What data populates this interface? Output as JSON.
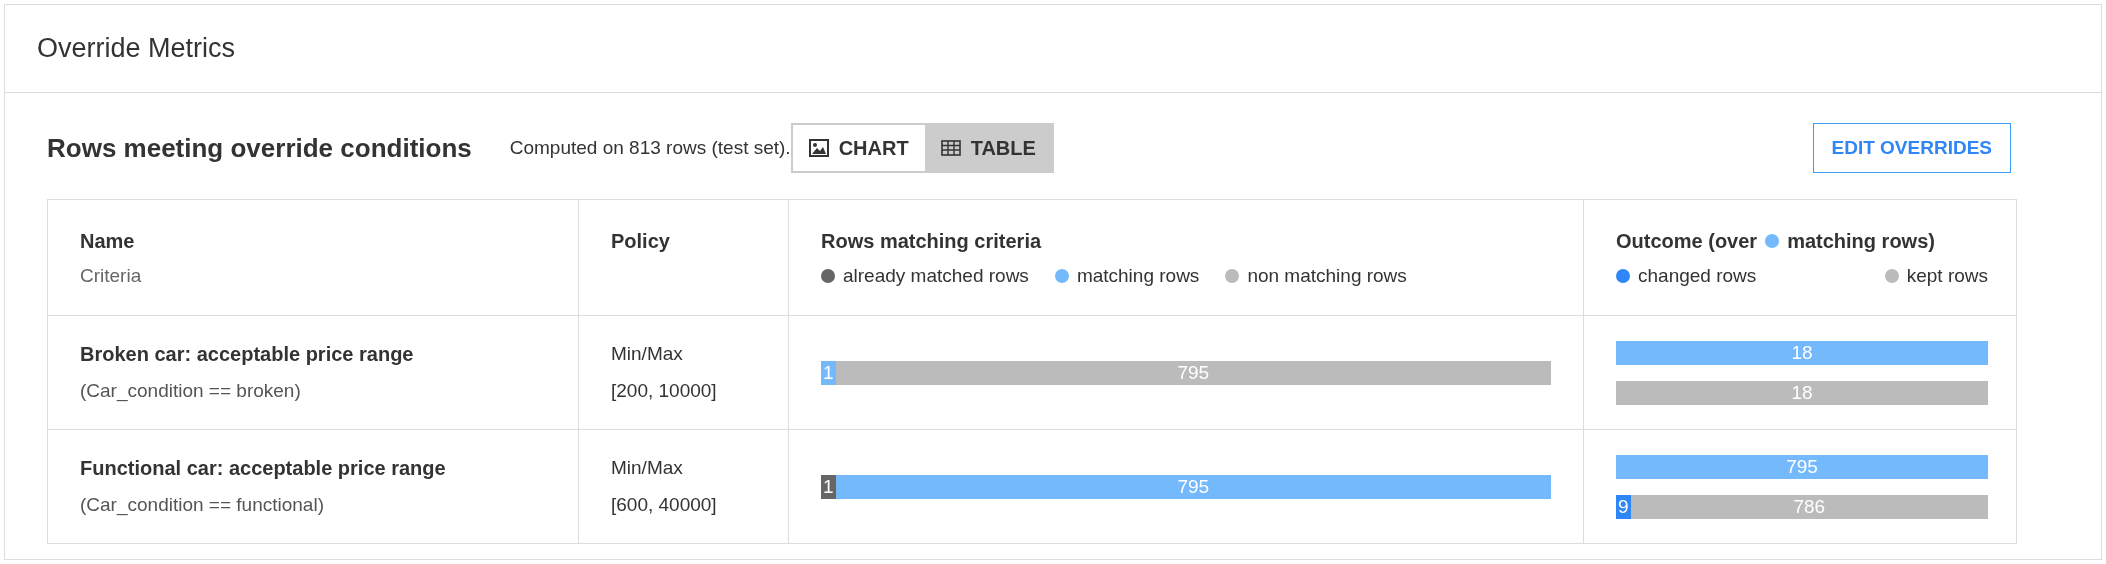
{
  "panel_title": "Override Metrics",
  "section": {
    "title": "Rows meeting override conditions",
    "computed_note": "Computed on 813 rows (test set).",
    "view_toggle": [
      {
        "label": "CHART",
        "kind": "image",
        "selected": false
      },
      {
        "label": "TABLE",
        "kind": "table",
        "selected": true
      }
    ],
    "edit_button": "EDIT OVERRIDES"
  },
  "table": {
    "columns": [
      {
        "title": "Name",
        "subtitle": "Criteria"
      },
      {
        "title": "Policy"
      },
      {
        "title": "Rows matching criteria",
        "legend": [
          {
            "label": "already matched rows",
            "color": "#666666"
          },
          {
            "label": "matching rows",
            "color": "#74b9fc"
          },
          {
            "label": "non matching rows",
            "color": "#bbbbbb"
          }
        ]
      },
      {
        "title_before": "Outcome (over",
        "title_after": "matching rows)",
        "legend": [
          {
            "label": "changed rows",
            "color": "#2f86f6"
          },
          {
            "label": "kept rows",
            "color": "#bbbbbb"
          }
        ]
      }
    ],
    "rows": [
      {
        "name": "Broken car: acceptable price range",
        "criteria": "(Car_condition == broken)",
        "policy": "Min/Max",
        "range": "[200, 10000]",
        "matching_bar": [
          {
            "label": "1",
            "color": "#74b9fc",
            "kind": "sliver"
          },
          {
            "label": "795",
            "color": "#bbbbbb",
            "kind": "rest"
          }
        ],
        "outcome_bars": [
          [
            {
              "label": "18",
              "color": "#74b9fc",
              "kind": "rest"
            }
          ],
          [
            {
              "label": "18",
              "color": "#bbbbbb",
              "kind": "rest"
            }
          ]
        ]
      },
      {
        "name": "Functional car: acceptable price range",
        "criteria": "(Car_condition == functional)",
        "policy": "Min/Max",
        "range": "[600, 40000]",
        "matching_bar": [
          {
            "label": "1",
            "color": "#666666",
            "kind": "sliver"
          },
          {
            "label": "795",
            "color": "#74b9fc",
            "kind": "rest"
          }
        ],
        "outcome_bars": [
          [
            {
              "label": "795",
              "color": "#74b9fc",
              "kind": "rest"
            }
          ],
          [
            {
              "label": "9",
              "color": "#2f86f6",
              "kind": "sliver"
            },
            {
              "label": "786",
              "color": "#bbbbbb",
              "kind": "rest"
            }
          ]
        ]
      }
    ]
  }
}
